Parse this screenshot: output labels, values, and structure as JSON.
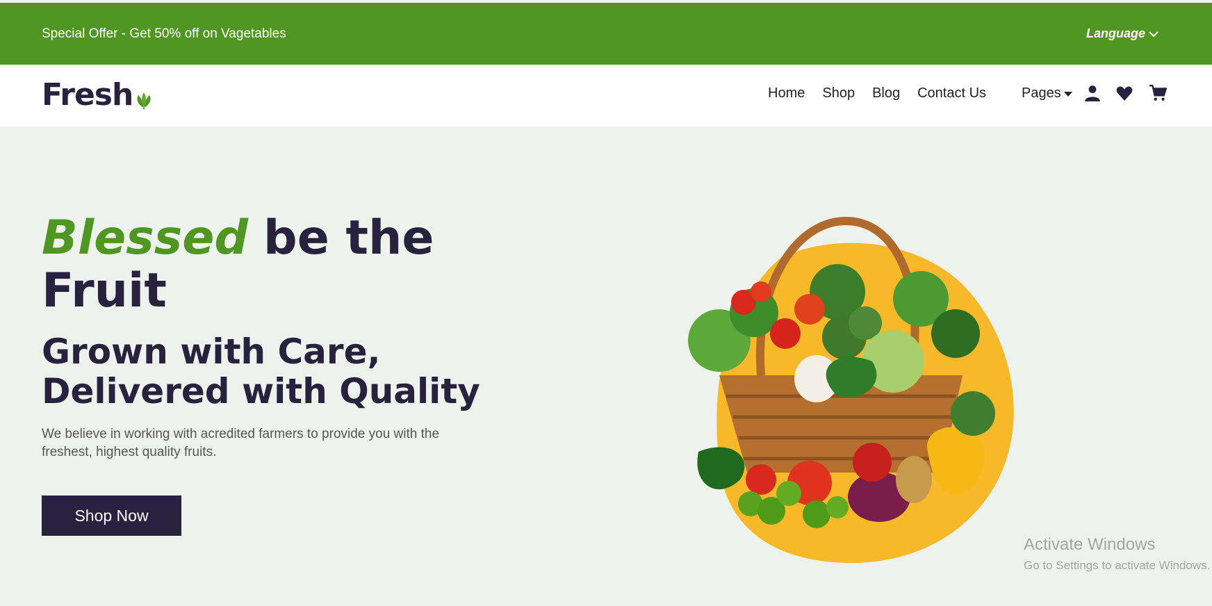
{
  "topbar": {
    "offer_text": "Special Offer - Get 50% off on Vagetables",
    "language_label": "Language"
  },
  "brand": {
    "name": "Fresh",
    "logo_icon": "leaf-icon"
  },
  "nav": {
    "links": [
      "Home",
      "Shop",
      "Blog",
      "Contact Us"
    ],
    "pages_label": "Pages",
    "icons": [
      "user-icon",
      "heart-icon",
      "cart-icon"
    ]
  },
  "hero": {
    "title_accent": "Blessed",
    "title_rest": "be the Fruit",
    "subtitle": "Grown with Care, Delivered with Quality",
    "description": "We believe in working with acredited farmers to provide you with the freshest, highest quality fruits.",
    "cta_label": "Shop Now"
  },
  "watermark": {
    "line1": "Activate Windows",
    "line2": "Go to Settings to activate Windows."
  },
  "colors": {
    "brand_green": "#4f9722",
    "dark_navy": "#28223f",
    "page_bg": "#eef2ec",
    "splash_yellow": "#f7b92a"
  }
}
